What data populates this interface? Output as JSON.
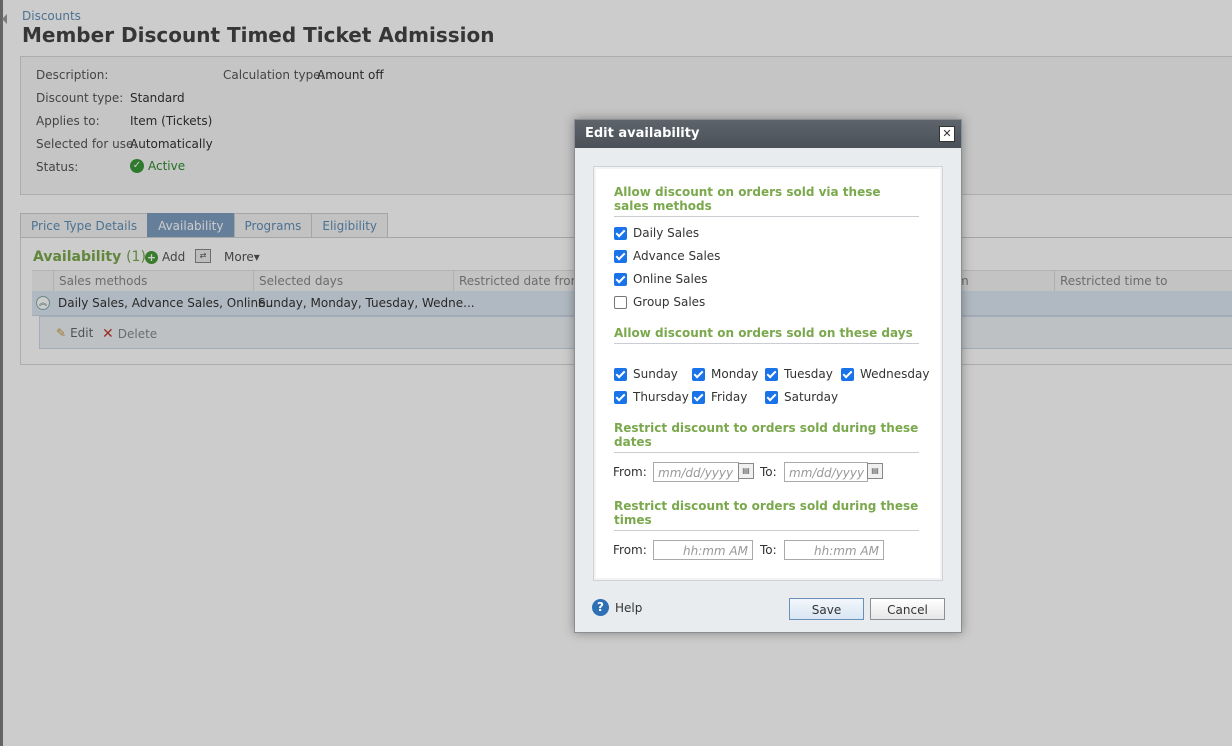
{
  "breadcrumb": "Discounts",
  "title": "Member Discount Timed Ticket Admission",
  "summary": {
    "description_label": "Description:",
    "calc_label": "Calculation type:",
    "calc_value": "Amount off",
    "type_label": "Discount type:",
    "type_value": "Standard",
    "applies_label": "Applies to:",
    "applies_value": "Item (Tickets)",
    "selected_label": "Selected for use:",
    "selected_value": "Automatically",
    "status_label": "Status:",
    "status_value": "Active"
  },
  "tabs": [
    "Price Type Details",
    "Availability",
    "Programs",
    "Eligibility"
  ],
  "availability": {
    "title": "Availability",
    "count": "(1)",
    "add_label": "Add",
    "more_label": "More▾",
    "columns": [
      "Sales methods",
      "Selected days",
      "Restricted date from",
      "m",
      "Restricted time to"
    ],
    "row": {
      "sales_methods": "Daily Sales, Advance Sales, Online...",
      "selected_days": "Sunday, Monday, Tuesday, Wedne..."
    },
    "edit_label": "Edit",
    "delete_label": "Delete"
  },
  "dialog": {
    "title": "Edit availability",
    "close": "✕",
    "sales_heading": "Allow discount on orders sold via these sales methods",
    "sales_methods": [
      {
        "label": "Daily Sales",
        "checked": true
      },
      {
        "label": "Advance Sales",
        "checked": true
      },
      {
        "label": "Online Sales",
        "checked": true
      },
      {
        "label": "Group Sales",
        "checked": false
      }
    ],
    "days_heading": "Allow discount on orders sold on these days",
    "days": [
      {
        "label": "Sunday",
        "checked": true
      },
      {
        "label": "Monday",
        "checked": true
      },
      {
        "label": "Tuesday",
        "checked": true
      },
      {
        "label": "Wednesday",
        "checked": true
      },
      {
        "label": "Thursday",
        "checked": true
      },
      {
        "label": "Friday",
        "checked": true
      },
      {
        "label": "Saturday",
        "checked": true
      }
    ],
    "dates_heading": "Restrict discount to orders sold during these dates",
    "times_heading": "Restrict discount to orders sold during these times",
    "from_label": "From:",
    "to_label": "To:",
    "date_placeholder": "mm/dd/yyyy",
    "time_placeholder": "hh:mm AM",
    "help_label": "Help",
    "save_label": "Save",
    "cancel_label": "Cancel"
  }
}
